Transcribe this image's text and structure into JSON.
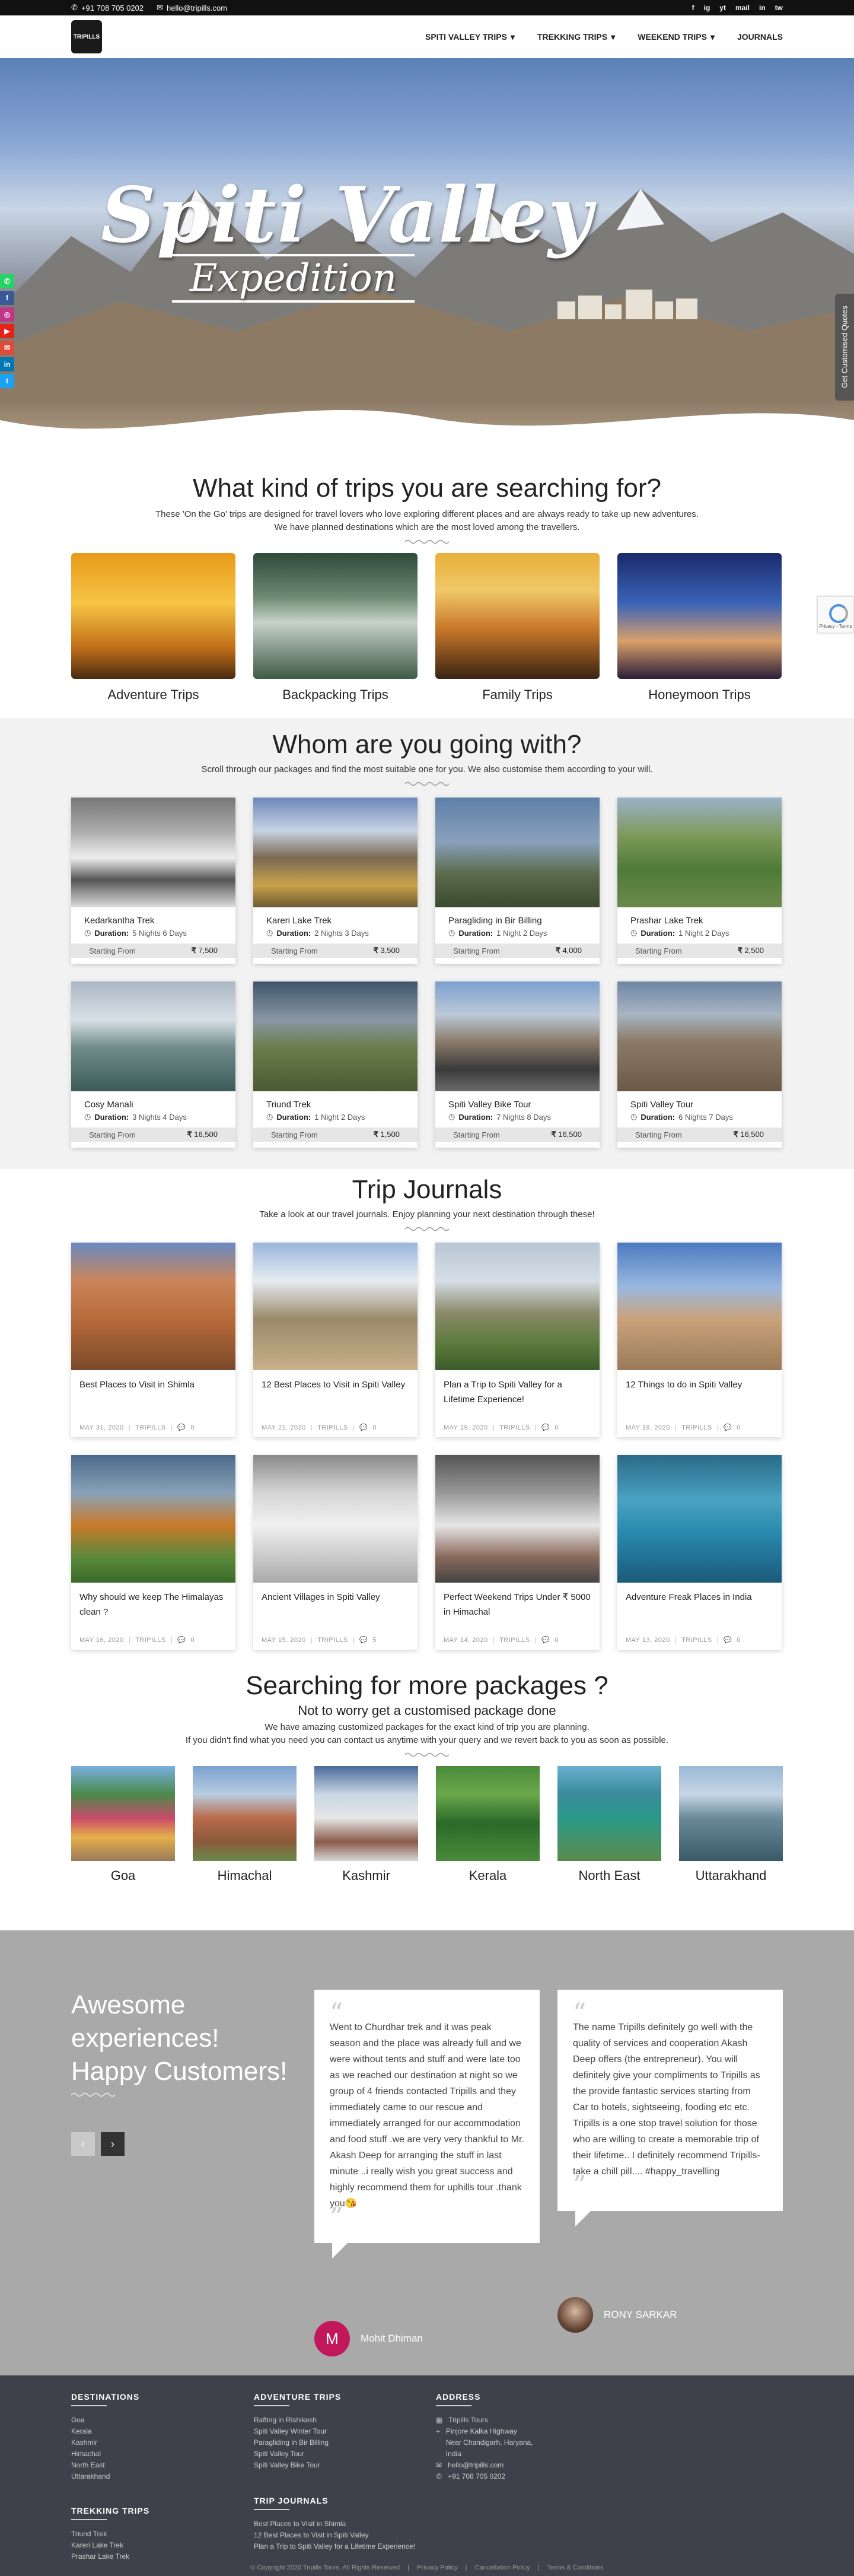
{
  "topbar": {
    "phone": "+91 708 705 0202",
    "email": "hello@tripills.com",
    "socials": [
      "f",
      "ig",
      "yt",
      "mail",
      "in",
      "tw"
    ]
  },
  "nav": {
    "logo_text": "TRIPILLS",
    "items": [
      {
        "label": "SPITI VALLEY TRIPS",
        "dropdown": true
      },
      {
        "label": "TREKKING TRIPS",
        "dropdown": true
      },
      {
        "label": "WEEKEND TRIPS",
        "dropdown": true
      },
      {
        "label": "JOURNALS",
        "dropdown": false
      }
    ]
  },
  "hero": {
    "title": "Spiti Valley",
    "subtitle": "Expedition",
    "quote_tab": "Get Customised Quotes",
    "recaptcha": "Privacy - Terms"
  },
  "side_social": [
    {
      "icon": "whatsapp-icon",
      "glyph": "✆",
      "color": "#25d366"
    },
    {
      "icon": "facebook-icon",
      "glyph": "f",
      "color": "#3b5998"
    },
    {
      "icon": "instagram-icon",
      "glyph": "◎",
      "color": "#c13584"
    },
    {
      "icon": "youtube-icon",
      "glyph": "▶",
      "color": "#e62117"
    },
    {
      "icon": "mail-icon",
      "glyph": "✉",
      "color": "#dd4b39"
    },
    {
      "icon": "linkedin-icon",
      "glyph": "in",
      "color": "#0077b5"
    },
    {
      "icon": "twitter-icon",
      "glyph": "t",
      "color": "#1da1f2"
    }
  ],
  "trip_types": {
    "title": "What kind of trips you are searching for?",
    "sub1": "These 'On the Go' trips are designed for travel lovers who love exploring different places and are always ready to take up new adventures.",
    "sub2": "We have planned destinations which are the most loved among the travellers.",
    "items": [
      {
        "label": "Adventure Trips",
        "bg": "linear-gradient(180deg,#e89a1a 0%,#f6c445 40%,#c2701a 75%,#4a2a10 100%)"
      },
      {
        "label": "Backpacking Trips",
        "bg": "linear-gradient(180deg,#2e4a3a 0%,#6c8a72 35%,#c7d2c8 55%,#3f5a45 100%)"
      },
      {
        "label": "Family Trips",
        "bg": "linear-gradient(180deg,#e8b03a 0%,#f0c868 30%,#c9782a 60%,#3a2412 100%)"
      },
      {
        "label": "Honeymoon Trips",
        "bg": "linear-gradient(180deg,#1a2a6a 0%,#3b62b8 40%,#d9a06a 70%,#2a1e3a 100%)"
      }
    ]
  },
  "going": {
    "title": "Whom are you going with?",
    "sub": "Scroll through our packages and find the most suitable one for you. We also customise them according to your will.",
    "duration_label": "Duration:",
    "starting_label": "Starting From",
    "packages": [
      {
        "name": "Kedarkantha Trek",
        "duration": "5 Nights 6 Days",
        "price": "7,500",
        "bg": "linear-gradient(180deg,#777 0%,#aaa 30%,#eee 55%,#555 75%,#ddd 100%)"
      },
      {
        "name": "Kareri Lake Trek",
        "duration": "2 Nights 3 Days",
        "price": "3,500",
        "bg": "linear-gradient(180deg,#6b86b8 0%,#c7d3e4 30%,#7a6a52 55%,#c9a24a 80%,#6d5a32 100%)"
      },
      {
        "name": "Paragliding in Bir Billing",
        "duration": "1 Night 2 Days",
        "price": "4,000",
        "bg": "linear-gradient(180deg,#5d7fa8 0%,#8aa1bd 40%,#5a6a4a 70%,#3c4a30 100%)"
      },
      {
        "name": "Prashar Lake Trek",
        "duration": "1 Night 2 Days",
        "price": "2,500",
        "bg": "linear-gradient(180deg,#9cb2c9 0%,#7c9a5a 35%,#4f7a38 65%,#6a8a4a 100%)"
      },
      {
        "name": "Cosy Manali",
        "duration": "3 Nights 4 Days",
        "price": "16,500",
        "bg": "linear-gradient(180deg,#aab8c4 0%,#d8e0e6 35%,#6f8c8a 60%,#3c5a58 100%)"
      },
      {
        "name": "Triund Trek",
        "duration": "1 Night 2 Days",
        "price": "1,500",
        "bg": "linear-gradient(180deg,#3e556a 0%,#8a97a5 35%,#6a7e4a 60%,#4a5a32 100%)"
      },
      {
        "name": "Spiti Valley Bike Tour",
        "duration": "7 Nights 8 Days",
        "price": "16,500",
        "bg": "linear-gradient(180deg,#7b9fd0 0%,#bcc9d8 30%,#8a7a6a 55%,#3a3a3a 80%,#6a6a6a 100%)"
      },
      {
        "name": "Spiti Valley Tour",
        "duration": "6 Nights 7 Days",
        "price": "16,500",
        "bg": "linear-gradient(180deg,#6e86a4 0%,#a8b4c2 30%,#8a7a66 55%,#6a5a46 100%)"
      }
    ]
  },
  "journals": {
    "title": "Trip Journals",
    "sub": "Take a look at our travel journals. Enjoy planning your next destination through these!",
    "posts": [
      {
        "title": "Best Places to Visit in Shimla",
        "date": "MAY 31, 2020",
        "cat": "TRIPILLS",
        "comments": "0",
        "bg": "linear-gradient(180deg,#6a8ac0 0%,#c9855a 30%,#b86a3a 60%,#7a4a2a 100%)"
      },
      {
        "title": "12 Best Places to Visit in Spiti Valley",
        "date": "MAY 21, 2020",
        "cat": "TRIPILLS",
        "comments": "0",
        "bg": "linear-gradient(180deg,#9ab6dc 0%,#e6ecf2 30%,#9a8a6a 60%,#c9b08a 100%)"
      },
      {
        "title": "Plan a Trip to Spiti Valley for a Lifetime Experience!",
        "date": "MAY 19, 2020",
        "cat": "TRIPILLS",
        "comments": "0",
        "bg": "linear-gradient(180deg,#b8c6d4 0%,#d6dee6 30%,#8a8a6a 55%,#5a7a3a 80%,#3a5a2a 100%)"
      },
      {
        "title": "12 Things to do in Spiti Valley",
        "date": "MAY 19, 2020",
        "cat": "TRIPILLS",
        "comments": "0",
        "bg": "linear-gradient(180deg,#4a7ac0 0%,#9ab8e0 35%,#c9a27a 60%,#9a7a5a 100%)"
      },
      {
        "title": "Why should we keep The Himalayas clean ?",
        "date": "MAY 16, 2020",
        "cat": "TRIPILLS",
        "comments": "0",
        "bg": "linear-gradient(180deg,#4a6a8a 0%,#8aa2b8 30%,#c97a2a 55%,#5a8a3a 80%,#3a6a2a 100%)"
      },
      {
        "title": "Ancient Villages in Spiti Valley",
        "date": "MAY 15, 2020",
        "cat": "TRIPILLS",
        "comments": "5",
        "bg": "linear-gradient(180deg,#8a8a8a 0%,#d6d6d6 30%,#f0f0f0 55%,#aaaaaa 100%)"
      },
      {
        "title": "Perfect Weekend Trips Under ₹ 5000 in Himachal",
        "date": "MAY 14, 2020",
        "cat": "TRIPILLS",
        "comments": "0",
        "bg": "linear-gradient(180deg,#555 0%,#999 30%,#e6e6e6 55%,#8a6a5a 80%,#444 100%)"
      },
      {
        "title": "Adventure Freak Places in India",
        "date": "MAY 13, 2020",
        "cat": "TRIPILLS",
        "comments": "0",
        "bg": "linear-gradient(180deg,#2a6a8a 0%,#4aa2c0 35%,#2a8ab0 60%,#1a5a7a 100%)"
      }
    ]
  },
  "more": {
    "title": "Searching for more packages ?",
    "sub_head": "Not to worry get a customised package done",
    "line1": "We have amazing customized packages for the exact kind of trip you are planning.",
    "line2": "If you didn't find what you need you can contact us anytime with your query and we revert back to you as soon as possible.",
    "destinations": [
      {
        "label": "Goa",
        "bg": "linear-gradient(180deg,#7ab0e0 0%,#4a8a4a 30%,#c94a6a 55%,#e6b04a 75%,#9a7a5a 100%)"
      },
      {
        "label": "Himachal",
        "bg": "linear-gradient(180deg,#7aa2d0 0%,#b8cce0 30%,#b86a4a 55%,#8a5a3a 80%,#6a8a4a 100%)"
      },
      {
        "label": "Kashmir",
        "bg": "linear-gradient(180deg,#4a6a9a 0%,#c9d6e4 30%,#e6e6e6 55%,#8a5a4a 80%,#d6d6d6 100%)"
      },
      {
        "label": "Kerala",
        "bg": "linear-gradient(180deg,#4a8a3a 0%,#6aa84a 30%,#2a6a2a 60%,#4a8a3a 100%)"
      },
      {
        "label": "North East",
        "bg": "linear-gradient(180deg,#6ab0d0 0%,#3a8a9a 30%,#2a9a8a 55%,#5a8a4a 100%)"
      },
      {
        "label": "Uttarakhand",
        "bg": "linear-gradient(180deg,#9ab8d6 0%,#c6d6e6 30%,#6a8a9a 55%,#3a5a6a 100%)"
      }
    ]
  },
  "testimonials": {
    "heading_lines": [
      "Awesome",
      "experiences!",
      "Happy Customers!"
    ],
    "prev": "‹",
    "next": "›",
    "items": [
      {
        "text": "Went to Churdhar trek and it was peak season and the place was already full and we were without tents and stuff and were late too as we reached our destination at night so we group of 4 friends contacted Tripills and they immediately came to our rescue and immediately arranged for our accommodation and food stuff .we are very very thankful to Mr. Akash Deep for arranging the stuff in last minute ..i really wish you great success and highly recommend them for uphills tour .thank you😘",
        "author": "Mohit Dhiman",
        "initial": "M",
        "avatar_color": "#c2185b"
      },
      {
        "text": "The name Tripills definitely go well with the quality of services and cooperation Akash Deep offers (the entrepreneur). You will definitely give your compliments to Tripills as the provide fantastic services starting from Car to hotels, sightseeing, fooding etc etc. Tripills is a one stop travel solution for those who are willing to create a memorable trip of their lifetime.. I definitely recommend Tripills- take a chill pill.... #happy_travelling",
        "author": "RONY SARKAR",
        "initial": "",
        "avatar_color": "#6a4a3a"
      }
    ]
  },
  "footer": {
    "destinations": {
      "title": "DESTINATIONS",
      "items": [
        "Goa",
        "Kerala",
        "Kashmir",
        "Himachal",
        "North East",
        "Uttarakhand"
      ]
    },
    "adventure": {
      "title": "ADVENTURE TRIPS",
      "items": [
        "Rafting in Rishikesh",
        "Spiti Valley Winter Tour",
        "Paragliding in Bir Billing",
        "Spiti Valley Tour",
        "Spiti Valley Bike Tour"
      ]
    },
    "address": {
      "title": "ADDRESS",
      "name": "Tripills Tours",
      "street": "Pinjore Kalka Highway",
      "city": "Near Chandigarh, Haryana,",
      "country": "India",
      "email": "hello@tripills.com",
      "phone": "+91 708 705 0202"
    },
    "trekking": {
      "title": "TREKKING TRIPS",
      "items": [
        "Triund Trek",
        "Kareri Lake Trek",
        "Prashar Lake Trek"
      ]
    },
    "journal": {
      "title": "TRIP JOURNALS",
      "items": [
        "Best Places to Visit in Shimla",
        "12 Best Places to Visit in Spiti Valley",
        "Plan a Trip to Spiti Valley for a Lifetime Experience!"
      ]
    },
    "copyright": "© Copyright 2020 Tripills Tours, All Rights Reserved",
    "links": [
      "Privacy Policy",
      "Cancellation Policy",
      "Terms & Conditions"
    ]
  }
}
